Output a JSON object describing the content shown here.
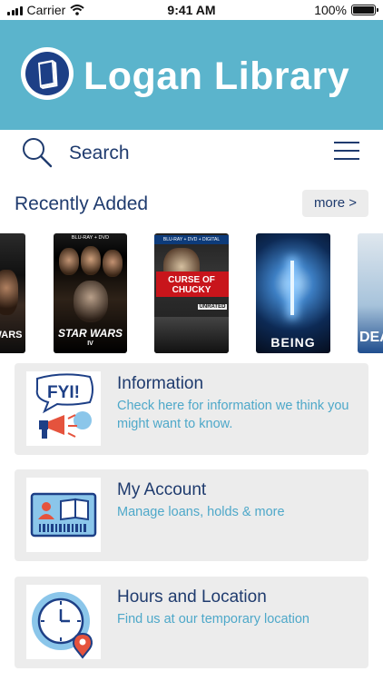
{
  "status_bar": {
    "carrier": "Carrier",
    "time": "9:41 AM",
    "battery": "100%",
    "battery_level": 1.0
  },
  "header": {
    "title": "Logan Library"
  },
  "search": {
    "placeholder": "Search"
  },
  "recently_added": {
    "title": "Recently Added",
    "more_label": "more >",
    "covers": [
      {
        "title_text": "WARS"
      },
      {
        "banner": "BLU-RAY + DVD",
        "title_text": "STAR WARS",
        "sub": "IV"
      },
      {
        "banner": "BLU-RAY + DVD + DIGITAL",
        "title_text": "CURSE OF CHUCKY",
        "sub": "UNRATED"
      },
      {
        "title_text": "BEING"
      },
      {
        "title_text": "DEA"
      }
    ]
  },
  "cards": [
    {
      "title": "Information",
      "description": "Check here for information we think you might want to know.",
      "icon_text": "FYI!"
    },
    {
      "title": "My Account",
      "description": "Manage loans, holds & more"
    },
    {
      "title": "Hours and Location",
      "description": "Find us at our temporary location"
    }
  ],
  "colors": {
    "header_bg": "#5bb4cc",
    "brand_blue": "#1d3f86",
    "text_dark": "#1f3b6e",
    "text_accent": "#4ea8c9",
    "card_bg": "#ececec"
  }
}
